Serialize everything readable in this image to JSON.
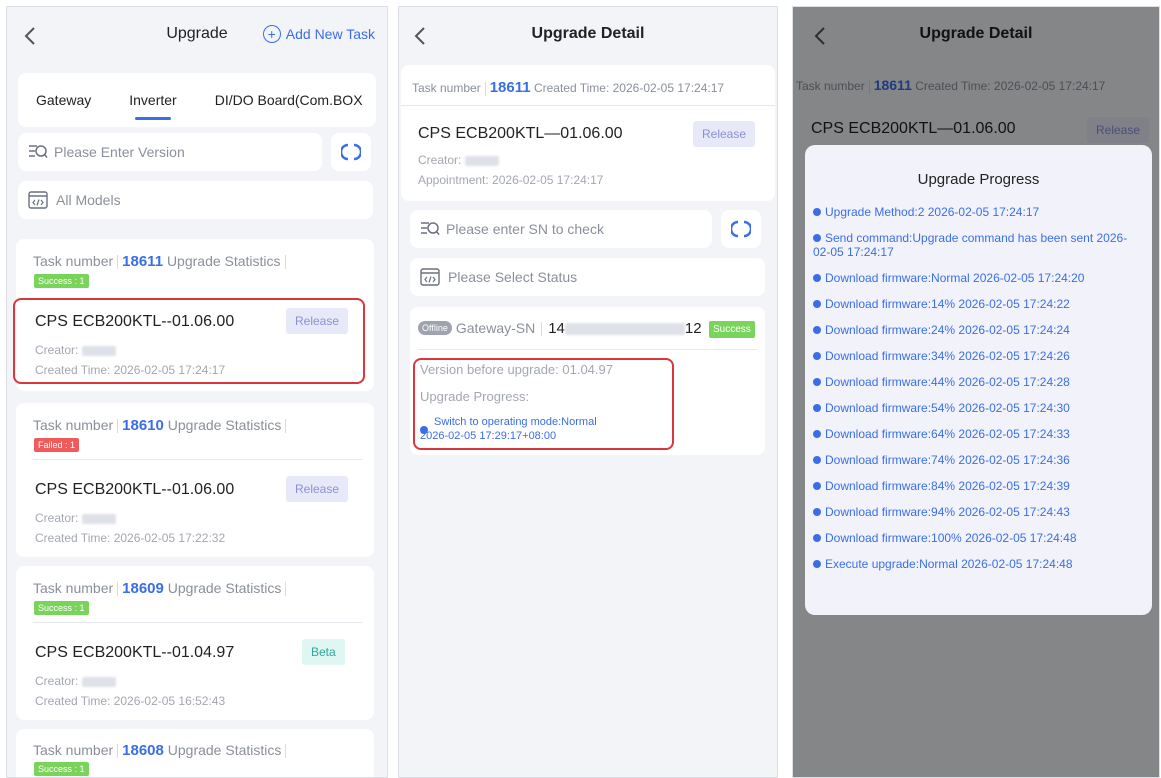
{
  "screen1": {
    "title": "Upgrade",
    "add_task_label": "Add New Task",
    "tabs": [
      "Gateway",
      "Inverter",
      "DI/DO Board(Com.BOX"
    ],
    "search_placeholder": "Please Enter Version",
    "models_label": "All Models",
    "tasks": [
      {
        "prefix": "Task number",
        "number": "18611",
        "suffix": "Upgrade Statistics",
        "status": "Success : 1",
        "version": "CPS ECB200KTL--01.06.00",
        "badge": "Release",
        "creator_label": "Creator:",
        "created_time": "Created Time:  2026-02-05 17:24:17"
      },
      {
        "prefix": "Task number",
        "number": "18610",
        "suffix": "Upgrade Statistics",
        "status": "Failed : 1",
        "version": "CPS ECB200KTL--01.06.00",
        "badge": "Release",
        "creator_label": "Creator:",
        "created_time": "Created Time:  2026-02-05 17:22:32"
      },
      {
        "prefix": "Task number",
        "number": "18609",
        "suffix": "Upgrade Statistics",
        "status": "Success : 1",
        "version": "CPS ECB200KTL--01.04.97",
        "badge": "Beta",
        "creator_label": "Creator:",
        "created_time": "Created Time:  2026-02-05 16:52:43"
      },
      {
        "prefix": "Task number",
        "number": "18608",
        "suffix": "Upgrade Statistics",
        "status": "Success : 1"
      }
    ]
  },
  "screen2": {
    "title": "Upgrade Detail",
    "task_label": "Task number",
    "task_number": "18611",
    "created": "Created Time: 2026-02-05 17:24:17",
    "version": "CPS ECB200KTL—01.06.00",
    "badge": "Release",
    "creator_label": "Creator:",
    "appointment": "Appointment: 2026-02-05 17:24:17",
    "sn_placeholder": "Please enter SN to check",
    "status_placeholder": "Please Select Status",
    "offline_tag": "Offline",
    "gateway_label": "Gateway-SN",
    "sn_start": "14",
    "sn_end": "12",
    "success_badge": "Success",
    "version_before": "Version before upgrade: 01.04.97",
    "progress_label": "Upgrade Progress:",
    "progress_line1": "Switch to operating mode:Normal",
    "progress_line2": "2026-02-05 17:29:17+08:00"
  },
  "screen3": {
    "title": "Upgrade Detail",
    "task_label": "Task number",
    "task_number": "18611",
    "created": "Created Time: 2026-02-05 17:24:17",
    "version": "CPS ECB200KTL—01.06.00",
    "badge": "Release",
    "modal_title": "Upgrade Progress",
    "progress": [
      "Upgrade Method:2   2026-02-05 17:24:17",
      "Send command:Upgrade command has been sent 2026-02-05 17:24:17",
      "Download firmware:Normal   2026-02-05 17:24:20",
      "Download firmware:14%   2026-02-05 17:24:22",
      "Download firmware:24%   2026-02-05 17:24:24",
      "Download firmware:34%   2026-02-05 17:24:26",
      "Download firmware:44%   2026-02-05 17:24:28",
      "Download firmware:54%   2026-02-05 17:24:30",
      "Download firmware:64%   2026-02-05 17:24:33",
      "Download firmware:74%   2026-02-05 17:24:36",
      "Download firmware:84%   2026-02-05 17:24:39",
      "Download firmware:94%   2026-02-05 17:24:43",
      "Download firmware:100%   2026-02-05 17:24:48",
      "Execute upgrade:Normal   2026-02-05 17:24:48"
    ]
  },
  "colors": {
    "accent": "#3a6ee8",
    "highlight": "#d9363e",
    "success": "#7ad35a",
    "failed": "#ef5b5b"
  },
  "icons": [
    "back-chevron-icon",
    "plus-circle-icon",
    "search-filter-icon",
    "refresh-icon",
    "select-list-icon"
  ]
}
